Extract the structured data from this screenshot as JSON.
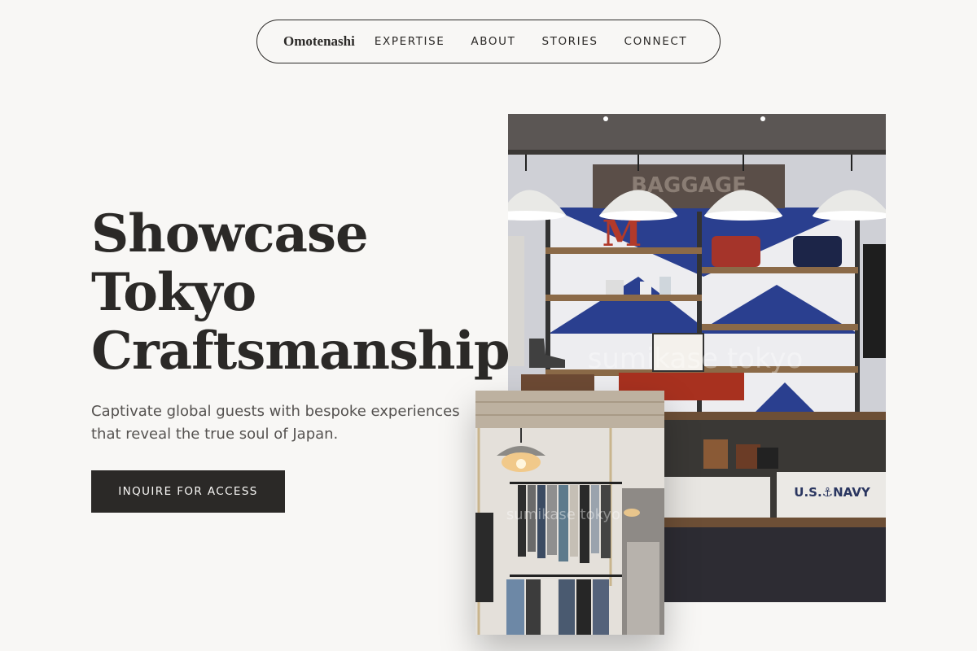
{
  "nav": {
    "brand": "Omotenashi",
    "links": [
      "EXPERTISE",
      "ABOUT",
      "STORIES",
      "CONNECT"
    ]
  },
  "hero": {
    "title_lines": [
      "Showcase",
      "Tokyo",
      "Craftsmanship."
    ],
    "subtitle": "Captivate global guests with bespoke experiences that reveal the true soul of Japan.",
    "cta_label": "INQUIRE FOR ACCESS"
  },
  "photos": {
    "main": {
      "sign_text": "BAGGAGE",
      "shirt_text": "U.S.⚓NAVY",
      "watermark": "sumikase tokyo"
    },
    "small": {
      "watermark": "sumikase tokyo"
    }
  },
  "colors": {
    "background": "#f8f7f5",
    "text": "#2b2927",
    "button": "#2b2927",
    "subtitle": "#555250"
  }
}
